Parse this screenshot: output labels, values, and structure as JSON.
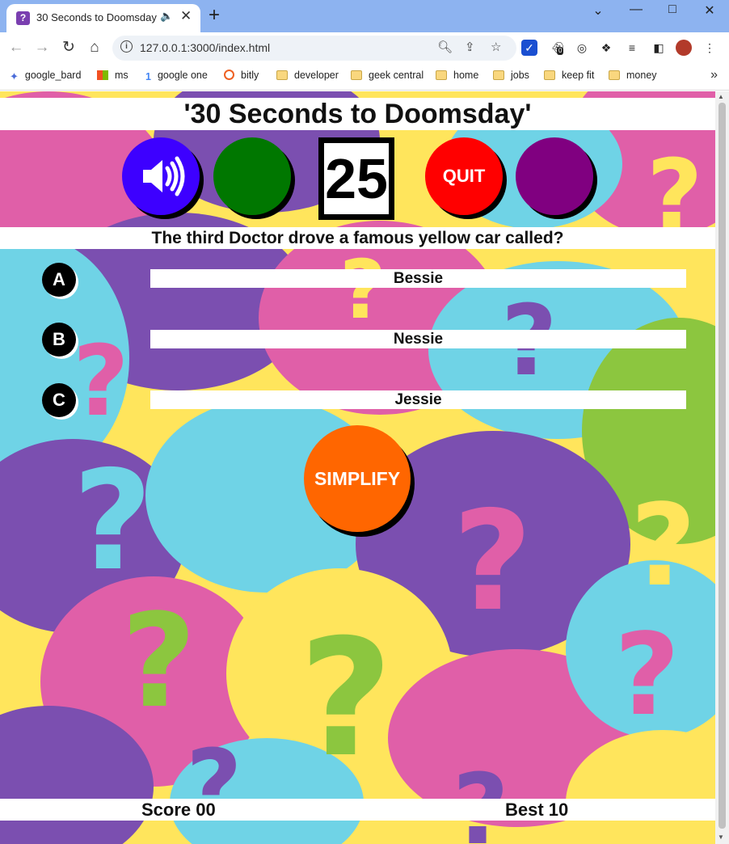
{
  "browser": {
    "tab_title": "30 Seconds to Doomsday",
    "url": "127.0.0.1:3000/index.html",
    "bookmarks": [
      "google_bard",
      "ms",
      "google one",
      "bitly",
      "developer",
      "geek central",
      "home",
      "jobs",
      "keep fit",
      "money"
    ],
    "extension_badge": "0"
  },
  "game": {
    "title": "'30 Seconds to Doomsday'",
    "timer": "25",
    "quit_label": "QUIT",
    "question": "The third Doctor drove a famous yellow car called?",
    "options": [
      {
        "letter": "A",
        "text": "Bessie"
      },
      {
        "letter": "B",
        "text": "Nessie"
      },
      {
        "letter": "C",
        "text": "Jessie"
      }
    ],
    "simplify_label": "SIMPLIFY",
    "score_label": "Score 00",
    "best_label": "Best 10"
  },
  "colors": {
    "sound_button": "#3d00ff",
    "green_button": "#007700",
    "quit_button": "#ff0000",
    "purple_button": "#800080",
    "simplify_button": "#ff6600"
  }
}
